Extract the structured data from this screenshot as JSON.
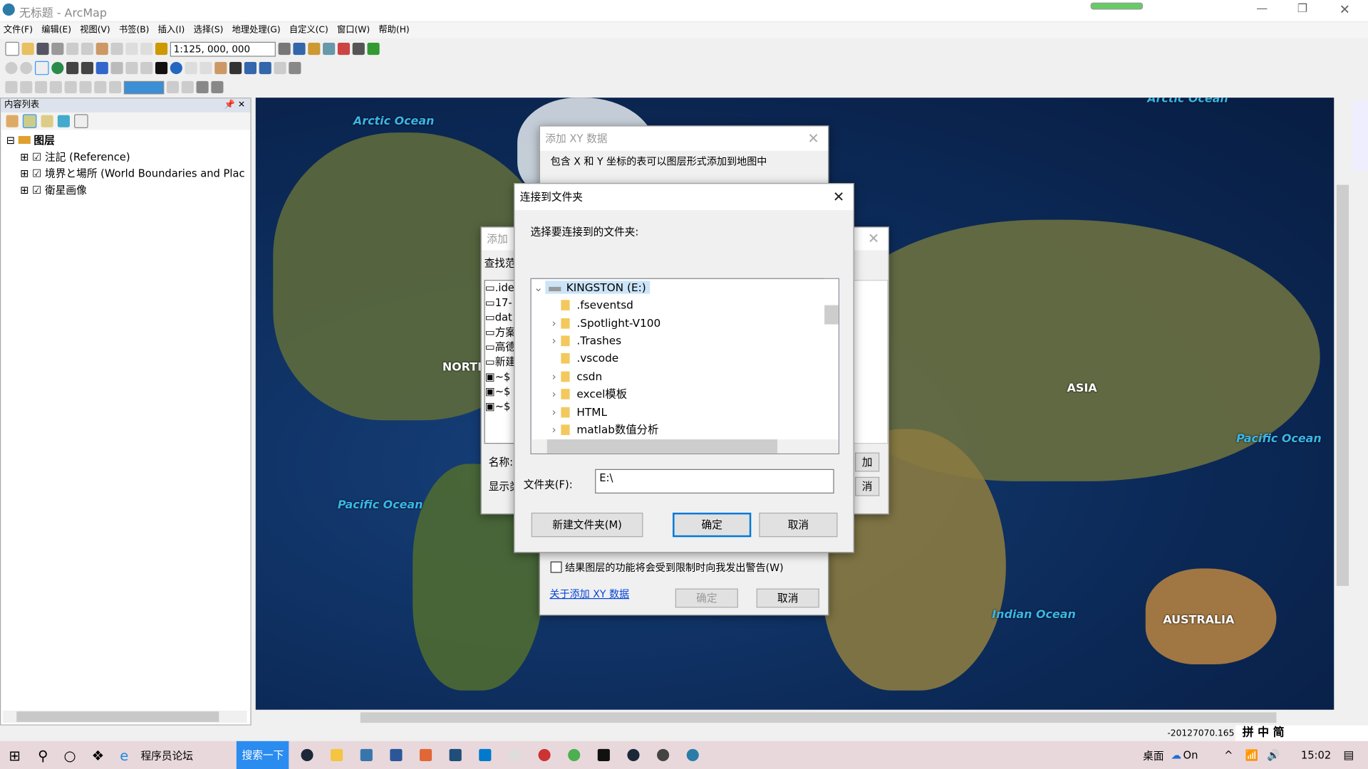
{
  "window": {
    "title": "无标题 - ArcMap"
  },
  "menu": [
    "文件(F)",
    "编辑(E)",
    "视图(V)",
    "书签(B)",
    "插入(I)",
    "选择(S)",
    "地理处理(G)",
    "自定义(C)",
    "窗口(W)",
    "帮助(H)"
  ],
  "toolbar": {
    "scale": "1:125, 000, 000"
  },
  "toc": {
    "title": "内容列表",
    "root": "图层",
    "layers": [
      {
        "name": "注記 (Reference)",
        "checked": true
      },
      {
        "name": "境界と場所 (World Boundaries and Places)",
        "checked": true
      },
      {
        "name": "衛星画像",
        "checked": true
      }
    ]
  },
  "map": {
    "labels": [
      "Arctic Ocean",
      "Arctic Ocean",
      "NORTH",
      "ASIA",
      "Pacific Ocean",
      "Pacific Ocean",
      "Indian Ocean",
      "AUSTRALIA"
    ]
  },
  "xy_dialog": {
    "title": "添加 XY 数据",
    "desc": "包含 X 和 Y 坐标的表可以图层形式添加到地图中",
    "warn_checkbox": "结果图层的功能将会受到限制时向我发出警告(W)",
    "about_link": "关于添加 XY 数据",
    "ok": "确定",
    "cancel": "取消"
  },
  "add_dialog": {
    "title": "添加",
    "lookin": "查找范",
    "name_label": "名称:",
    "show_label": "显示类",
    "items": [
      ".ide",
      "17-",
      "dat",
      "方案",
      "高德",
      "新建",
      "~$",
      "~$",
      "~$"
    ],
    "btn1": "加",
    "btn2": "消"
  },
  "folder_dialog": {
    "title": "连接到文件夹",
    "prompt": "选择要连接到的文件夹:",
    "drive": "KINGSTON (E:)",
    "folders": [
      {
        "name": ".fseventsd",
        "expandable": false
      },
      {
        "name": ".Spotlight-V100",
        "expandable": true
      },
      {
        "name": ".Trashes",
        "expandable": true
      },
      {
        "name": ".vscode",
        "expandable": false
      },
      {
        "name": "csdn",
        "expandable": true
      },
      {
        "name": "excel模板",
        "expandable": true
      },
      {
        "name": "HTML",
        "expandable": true
      },
      {
        "name": "matlab数值分析",
        "expandable": true
      }
    ],
    "folder_label": "文件夹(F):",
    "folder_value": "E:\\",
    "new_folder": "新建文件夹(M)",
    "ok": "确定",
    "cancel": "取消"
  },
  "status": {
    "coords": "-20127070.165"
  },
  "ime": "拼 中 简",
  "taskbar": {
    "ie_label": "程序员论坛",
    "search_btn": "搜索一下",
    "desktop": "桌面",
    "onedrive": "On",
    "clock": "15:02"
  }
}
